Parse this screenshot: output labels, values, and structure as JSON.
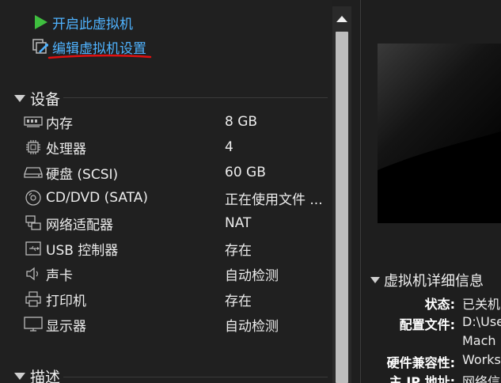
{
  "actions": {
    "power_on": "开启此虚拟机",
    "edit_settings": "编辑虚拟机设置"
  },
  "sections": {
    "devices": "设备",
    "description": "描述"
  },
  "devices": [
    {
      "name": "内存",
      "value": "8 GB",
      "icon": "memory-icon"
    },
    {
      "name": "处理器",
      "value": "4",
      "icon": "processor-icon"
    },
    {
      "name": "硬盘 (SCSI)",
      "value": "60 GB",
      "icon": "hard-disk-icon"
    },
    {
      "name": "CD/DVD (SATA)",
      "value": "正在使用文件 ...",
      "icon": "cd-dvd-icon"
    },
    {
      "name": "网络适配器",
      "value": "NAT",
      "icon": "network-adapter-icon"
    },
    {
      "name": "USB 控制器",
      "value": "存在",
      "icon": "usb-icon"
    },
    {
      "name": "声卡",
      "value": "自动检测",
      "icon": "speaker-icon"
    },
    {
      "name": "打印机",
      "value": "存在",
      "icon": "printer-icon"
    },
    {
      "name": "显示器",
      "value": "自动检测",
      "icon": "monitor-icon"
    }
  ],
  "details": {
    "header": "虚拟机详细信息",
    "rows": [
      {
        "label": "状态:",
        "value": "已关机"
      },
      {
        "label": "配置文件:",
        "value": "D:\\Use"
      },
      {
        "label": "",
        "value": "Mach"
      },
      {
        "label": "硬件兼容性:",
        "value": "Works"
      },
      {
        "label": "主 IP 地址:",
        "value": "网络信"
      }
    ]
  },
  "colors": {
    "link": "#4fb3ff",
    "play_icon": "#3fbf3f",
    "annotation": "#e01010",
    "background": "#1f1f1f"
  }
}
